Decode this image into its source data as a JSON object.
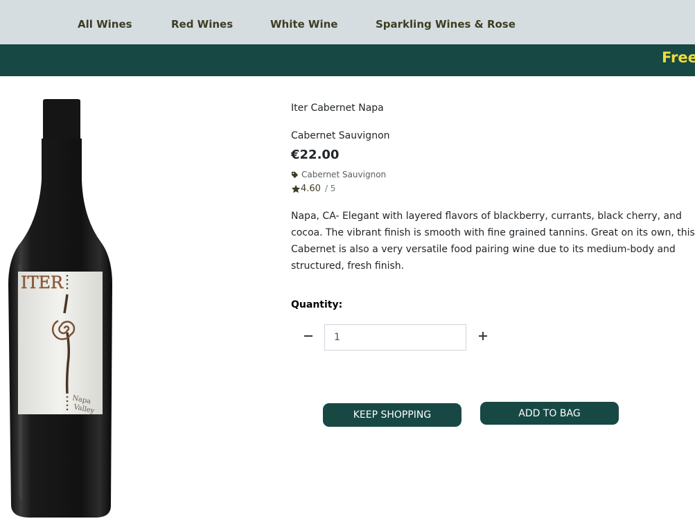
{
  "nav": {
    "items": [
      "All Wines",
      "Red Wines",
      "White Wine",
      "Sparkling Wines & Rose"
    ]
  },
  "banner": {
    "text": "Free"
  },
  "product": {
    "name": "Iter Cabernet Napa",
    "variety": "Cabernet Sauvignon",
    "price": "€22.00",
    "category": "Cabernet Sauvignon",
    "category_icon": "tag-icon",
    "rating": "4.60",
    "rating_max": "/ 5",
    "rating_icon": "star-icon",
    "description": "Napa, CA- Elegant with layered flavors of blackberry, currants, black cherry, and cocoa. The vibrant finish is smooth with fine grained tannins. Great on its own, this Cabernet is also a very versatile food pairing wine due to its medium-body and structured, fresh finish.",
    "label_brand": "ITER",
    "label_region": "Napa Valley"
  },
  "quantity": {
    "label": "Quantity:",
    "value": "1"
  },
  "actions": {
    "keep_shopping": "KEEP SHOPPING",
    "add_to_bag": "ADD TO BAG"
  },
  "colors": {
    "nav_bg": "#d6dde0",
    "brand_green": "#174844",
    "banner_text": "#eedc3a",
    "nav_text": "#3c3d24"
  }
}
